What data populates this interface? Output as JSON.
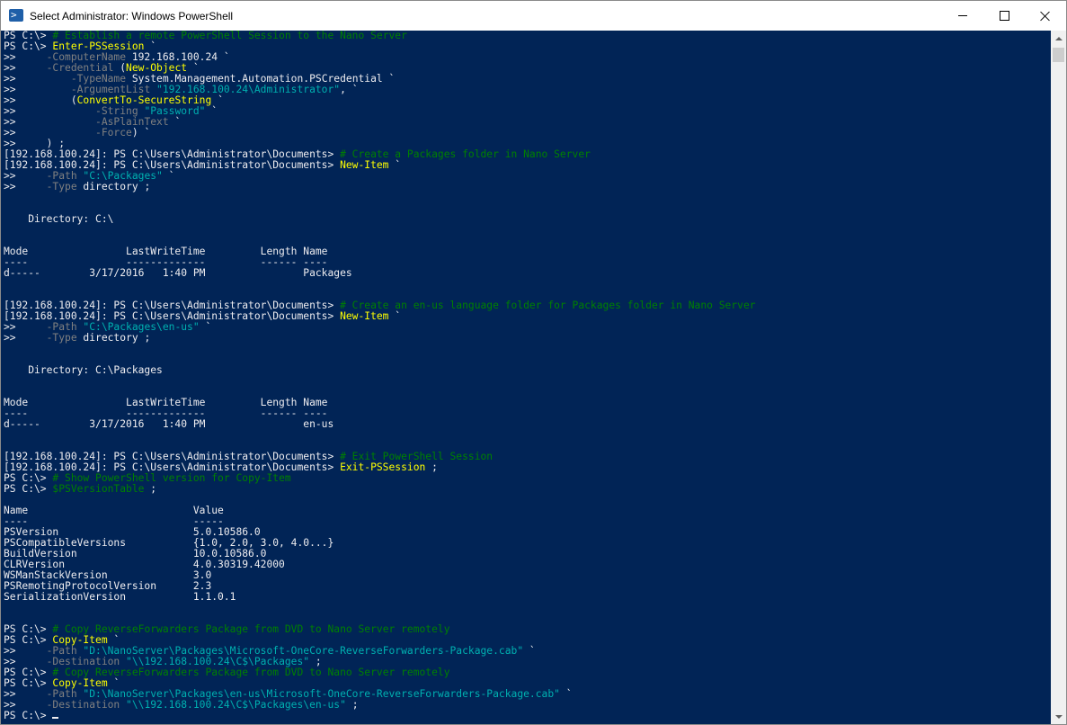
{
  "window": {
    "title": "Select Administrator: Windows PowerShell",
    "icon": "powershell-icon",
    "controls": {
      "minimize": "minimize-icon",
      "maximize": "maximize-icon",
      "close": "close-icon"
    }
  },
  "colors": {
    "console_background": "#012456",
    "text": "#eeedf0",
    "command": "#ffff00",
    "comment": "#008000",
    "parameter": "#808080",
    "string": "#00b0b0"
  },
  "console": {
    "lines": [
      [
        [
          "w",
          "PS C:\\> "
        ],
        [
          "c",
          "# Establish a remote PowerShell Session to the Nano Server"
        ]
      ],
      [
        [
          "w",
          "PS C:\\> "
        ],
        [
          "y",
          "Enter-PSSession"
        ],
        [
          "w",
          " `"
        ]
      ],
      [
        [
          "w",
          ">>     "
        ],
        [
          "g",
          "-ComputerName"
        ],
        [
          "w",
          " 192.168.100.24 `"
        ]
      ],
      [
        [
          "w",
          ">>     "
        ],
        [
          "g",
          "-Credential"
        ],
        [
          "w",
          " ("
        ],
        [
          "y",
          "New-Object"
        ],
        [
          "w",
          " `"
        ]
      ],
      [
        [
          "w",
          ">>         "
        ],
        [
          "g",
          "-TypeName"
        ],
        [
          "w",
          " System.Management.Automation.PSCredential `"
        ]
      ],
      [
        [
          "w",
          ">>         "
        ],
        [
          "g",
          "-ArgumentList"
        ],
        [
          "s",
          " \"192.168.100.24\\Administrator\""
        ],
        [
          "w",
          ", `"
        ]
      ],
      [
        [
          "w",
          ">>         ("
        ],
        [
          "y",
          "ConvertTo-SecureString"
        ],
        [
          "w",
          " `"
        ]
      ],
      [
        [
          "w",
          ">>             "
        ],
        [
          "g",
          "-String"
        ],
        [
          "s",
          " \"Password\""
        ],
        [
          "w",
          " `"
        ]
      ],
      [
        [
          "w",
          ">>             "
        ],
        [
          "g",
          "-AsPlainText"
        ],
        [
          "w",
          " `"
        ]
      ],
      [
        [
          "w",
          ">>             "
        ],
        [
          "g",
          "-Force"
        ],
        [
          "w",
          ") `"
        ]
      ],
      [
        [
          "w",
          ">>     ) ;"
        ]
      ],
      [
        [
          "w",
          "[192.168.100.24]: PS C:\\Users\\Administrator\\Documents> "
        ],
        [
          "c",
          "# Create a Packages folder in Nano Server"
        ]
      ],
      [
        [
          "w",
          "[192.168.100.24]: PS C:\\Users\\Administrator\\Documents> "
        ],
        [
          "y",
          "New-Item"
        ],
        [
          "w",
          " `"
        ]
      ],
      [
        [
          "w",
          ">>     "
        ],
        [
          "g",
          "-Path"
        ],
        [
          "s",
          " \"C:\\Packages\""
        ],
        [
          "w",
          " `"
        ]
      ],
      [
        [
          "w",
          ">>     "
        ],
        [
          "g",
          "-Type"
        ],
        [
          "w",
          " directory ;"
        ]
      ],
      [
        [
          "w",
          ""
        ]
      ],
      [
        [
          "w",
          ""
        ]
      ],
      [
        [
          "w",
          "    Directory: C:\\"
        ]
      ],
      [
        [
          "w",
          ""
        ]
      ],
      [
        [
          "w",
          ""
        ]
      ],
      [
        [
          "w",
          "Mode                LastWriteTime         Length Name"
        ]
      ],
      [
        [
          "w",
          "----                -------------         ------ ----"
        ]
      ],
      [
        [
          "w",
          "d-----        3/17/2016   1:40 PM                Packages"
        ]
      ],
      [
        [
          "w",
          ""
        ]
      ],
      [
        [
          "w",
          ""
        ]
      ],
      [
        [
          "w",
          "[192.168.100.24]: PS C:\\Users\\Administrator\\Documents> "
        ],
        [
          "c",
          "# Create an en-us language folder for Packages folder in Nano Server"
        ]
      ],
      [
        [
          "w",
          "[192.168.100.24]: PS C:\\Users\\Administrator\\Documents> "
        ],
        [
          "y",
          "New-Item"
        ],
        [
          "w",
          " `"
        ]
      ],
      [
        [
          "w",
          ">>     "
        ],
        [
          "g",
          "-Path"
        ],
        [
          "s",
          " \"C:\\Packages\\en-us\""
        ],
        [
          "w",
          " `"
        ]
      ],
      [
        [
          "w",
          ">>     "
        ],
        [
          "g",
          "-Type"
        ],
        [
          "w",
          " directory ;"
        ]
      ],
      [
        [
          "w",
          ""
        ]
      ],
      [
        [
          "w",
          ""
        ]
      ],
      [
        [
          "w",
          "    Directory: C:\\Packages"
        ]
      ],
      [
        [
          "w",
          ""
        ]
      ],
      [
        [
          "w",
          ""
        ]
      ],
      [
        [
          "w",
          "Mode                LastWriteTime         Length Name"
        ]
      ],
      [
        [
          "w",
          "----                -------------         ------ ----"
        ]
      ],
      [
        [
          "w",
          "d-----        3/17/2016   1:40 PM                en-us"
        ]
      ],
      [
        [
          "w",
          ""
        ]
      ],
      [
        [
          "w",
          ""
        ]
      ],
      [
        [
          "w",
          "[192.168.100.24]: PS C:\\Users\\Administrator\\Documents> "
        ],
        [
          "c",
          "# Exit PowerShell Session"
        ]
      ],
      [
        [
          "w",
          "[192.168.100.24]: PS C:\\Users\\Administrator\\Documents> "
        ],
        [
          "y",
          "Exit-PSSession"
        ],
        [
          "w",
          " ;"
        ]
      ],
      [
        [
          "w",
          "PS C:\\> "
        ],
        [
          "c",
          "# Show PowerShell version for Copy-Item"
        ]
      ],
      [
        [
          "w",
          "PS C:\\> "
        ],
        [
          "c",
          "$PSVersionTable"
        ],
        [
          "w",
          " ;"
        ]
      ],
      [
        [
          "w",
          ""
        ]
      ],
      [
        [
          "w",
          "Name                           Value"
        ]
      ],
      [
        [
          "w",
          "----                           -----"
        ]
      ],
      [
        [
          "w",
          "PSVersion                      5.0.10586.0"
        ]
      ],
      [
        [
          "w",
          "PSCompatibleVersions           {1.0, 2.0, 3.0, 4.0...}"
        ]
      ],
      [
        [
          "w",
          "BuildVersion                   10.0.10586.0"
        ]
      ],
      [
        [
          "w",
          "CLRVersion                     4.0.30319.42000"
        ]
      ],
      [
        [
          "w",
          "WSManStackVersion              3.0"
        ]
      ],
      [
        [
          "w",
          "PSRemotingProtocolVersion      2.3"
        ]
      ],
      [
        [
          "w",
          "SerializationVersion           1.1.0.1"
        ]
      ],
      [
        [
          "w",
          ""
        ]
      ],
      [
        [
          "w",
          ""
        ]
      ],
      [
        [
          "w",
          "PS C:\\> "
        ],
        [
          "c",
          "# Copy ReverseForwarders Package from DVD to Nano Server remotely"
        ]
      ],
      [
        [
          "w",
          "PS C:\\> "
        ],
        [
          "y",
          "Copy-Item"
        ],
        [
          "w",
          " `"
        ]
      ],
      [
        [
          "w",
          ">>     "
        ],
        [
          "g",
          "-Path"
        ],
        [
          "s",
          " \"D:\\NanoServer\\Packages\\Microsoft-OneCore-ReverseForwarders-Package.cab\""
        ],
        [
          "w",
          " `"
        ]
      ],
      [
        [
          "w",
          ">>     "
        ],
        [
          "g",
          "-Destination"
        ],
        [
          "s",
          " \"\\\\192.168.100.24\\C$\\Packages\""
        ],
        [
          "w",
          " ;"
        ]
      ],
      [
        [
          "w",
          "PS C:\\> "
        ],
        [
          "c",
          "# Copy ReverseForwarders Package from DVD to Nano Server remotely"
        ]
      ],
      [
        [
          "w",
          "PS C:\\> "
        ],
        [
          "y",
          "Copy-Item"
        ],
        [
          "w",
          " `"
        ]
      ],
      [
        [
          "w",
          ">>     "
        ],
        [
          "g",
          "-Path"
        ],
        [
          "s",
          " \"D:\\NanoServer\\Packages\\en-us\\Microsoft-OneCore-ReverseForwarders-Package.cab\""
        ],
        [
          "w",
          " `"
        ]
      ],
      [
        [
          "w",
          ">>     "
        ],
        [
          "g",
          "-Destination"
        ],
        [
          "s",
          " \"\\\\192.168.100.24\\C$\\Packages\\en-us\""
        ],
        [
          "w",
          " ;"
        ]
      ],
      [
        [
          "w",
          "PS C:\\> "
        ]
      ]
    ]
  }
}
